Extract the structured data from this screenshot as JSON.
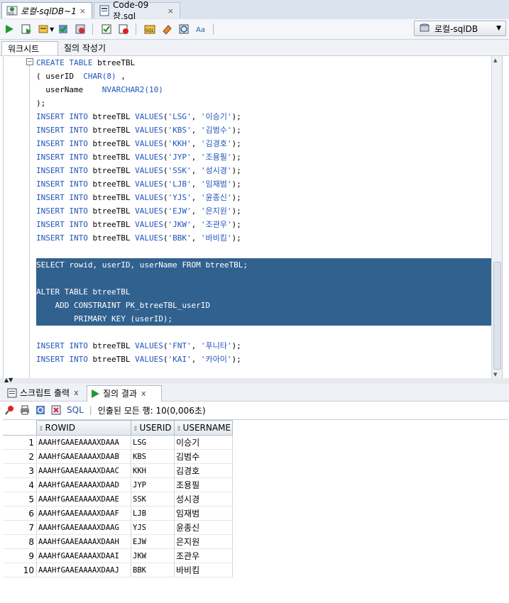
{
  "doc_tabs": [
    {
      "label": "로컬-sqlDB~1",
      "close": "×",
      "icon": "sql-worksheet-icon"
    },
    {
      "label": "Code-09장.sql",
      "close": "×",
      "icon": "sql-file-icon"
    }
  ],
  "toolbar": {
    "connection": "로컬-sqlDB",
    "connection_dropdown": "▼"
  },
  "sub_tabs": {
    "worksheet": "워크시트",
    "query_builder": "질의 작성기"
  },
  "editor": {
    "fold_marker": "−",
    "lines": [
      [
        {
          "t": "CREATE TABLE ",
          "c": "kw"
        },
        {
          "t": "btreeTBL",
          "c": ""
        }
      ],
      [
        {
          "t": "( userID  ",
          "c": ""
        },
        {
          "t": "CHAR(8)",
          "c": "kw"
        },
        {
          "t": " ,",
          "c": ""
        }
      ],
      [
        {
          "t": "  userName    ",
          "c": ""
        },
        {
          "t": "NVARCHAR2(10)",
          "c": "kw"
        }
      ],
      [
        {
          "t": ");",
          "c": ""
        }
      ],
      [
        {
          "t": "INSERT INTO ",
          "c": "kw"
        },
        {
          "t": "btreeTBL ",
          "c": ""
        },
        {
          "t": "VALUES",
          "c": "kw"
        },
        {
          "t": "(",
          "c": ""
        },
        {
          "t": "'LSG'",
          "c": "str"
        },
        {
          "t": ", ",
          "c": ""
        },
        {
          "t": "'이승기'",
          "c": "str"
        },
        {
          "t": ");",
          "c": ""
        }
      ],
      [
        {
          "t": "INSERT INTO ",
          "c": "kw"
        },
        {
          "t": "btreeTBL ",
          "c": ""
        },
        {
          "t": "VALUES",
          "c": "kw"
        },
        {
          "t": "(",
          "c": ""
        },
        {
          "t": "'KBS'",
          "c": "str"
        },
        {
          "t": ", ",
          "c": ""
        },
        {
          "t": "'김범수'",
          "c": "str"
        },
        {
          "t": ");",
          "c": ""
        }
      ],
      [
        {
          "t": "INSERT INTO ",
          "c": "kw"
        },
        {
          "t": "btreeTBL ",
          "c": ""
        },
        {
          "t": "VALUES",
          "c": "kw"
        },
        {
          "t": "(",
          "c": ""
        },
        {
          "t": "'KKH'",
          "c": "str"
        },
        {
          "t": ", ",
          "c": ""
        },
        {
          "t": "'김경호'",
          "c": "str"
        },
        {
          "t": ");",
          "c": ""
        }
      ],
      [
        {
          "t": "INSERT INTO ",
          "c": "kw"
        },
        {
          "t": "btreeTBL ",
          "c": ""
        },
        {
          "t": "VALUES",
          "c": "kw"
        },
        {
          "t": "(",
          "c": ""
        },
        {
          "t": "'JYP'",
          "c": "str"
        },
        {
          "t": ", ",
          "c": ""
        },
        {
          "t": "'조용필'",
          "c": "str"
        },
        {
          "t": ");",
          "c": ""
        }
      ],
      [
        {
          "t": "INSERT INTO ",
          "c": "kw"
        },
        {
          "t": "btreeTBL ",
          "c": ""
        },
        {
          "t": "VALUES",
          "c": "kw"
        },
        {
          "t": "(",
          "c": ""
        },
        {
          "t": "'SSK'",
          "c": "str"
        },
        {
          "t": ", ",
          "c": ""
        },
        {
          "t": "'성시경'",
          "c": "str"
        },
        {
          "t": ");",
          "c": ""
        }
      ],
      [
        {
          "t": "INSERT INTO ",
          "c": "kw"
        },
        {
          "t": "btreeTBL ",
          "c": ""
        },
        {
          "t": "VALUES",
          "c": "kw"
        },
        {
          "t": "(",
          "c": ""
        },
        {
          "t": "'LJB'",
          "c": "str"
        },
        {
          "t": ", ",
          "c": ""
        },
        {
          "t": "'임재범'",
          "c": "str"
        },
        {
          "t": ");",
          "c": ""
        }
      ],
      [
        {
          "t": "INSERT INTO ",
          "c": "kw"
        },
        {
          "t": "btreeTBL ",
          "c": ""
        },
        {
          "t": "VALUES",
          "c": "kw"
        },
        {
          "t": "(",
          "c": ""
        },
        {
          "t": "'YJS'",
          "c": "str"
        },
        {
          "t": ", ",
          "c": ""
        },
        {
          "t": "'윤종신'",
          "c": "str"
        },
        {
          "t": ");",
          "c": ""
        }
      ],
      [
        {
          "t": "INSERT INTO ",
          "c": "kw"
        },
        {
          "t": "btreeTBL ",
          "c": ""
        },
        {
          "t": "VALUES",
          "c": "kw"
        },
        {
          "t": "(",
          "c": ""
        },
        {
          "t": "'EJW'",
          "c": "str"
        },
        {
          "t": ", ",
          "c": ""
        },
        {
          "t": "'은지원'",
          "c": "str"
        },
        {
          "t": ");",
          "c": ""
        }
      ],
      [
        {
          "t": "INSERT INTO ",
          "c": "kw"
        },
        {
          "t": "btreeTBL ",
          "c": ""
        },
        {
          "t": "VALUES",
          "c": "kw"
        },
        {
          "t": "(",
          "c": ""
        },
        {
          "t": "'JKW'",
          "c": "str"
        },
        {
          "t": ", ",
          "c": ""
        },
        {
          "t": "'조관우'",
          "c": "str"
        },
        {
          "t": ");",
          "c": ""
        }
      ],
      [
        {
          "t": "INSERT INTO ",
          "c": "kw"
        },
        {
          "t": "btreeTBL ",
          "c": ""
        },
        {
          "t": "VALUES",
          "c": "kw"
        },
        {
          "t": "(",
          "c": ""
        },
        {
          "t": "'BBK'",
          "c": "str"
        },
        {
          "t": ", ",
          "c": ""
        },
        {
          "t": "'바비킴'",
          "c": "str"
        },
        {
          "t": ");",
          "c": ""
        }
      ],
      [],
      [
        {
          "t": "SELECT ",
          "c": "kw",
          "sel": 1
        },
        {
          "t": "rowid, userID, userName ",
          "c": "",
          "sel": 1
        },
        {
          "t": "FROM ",
          "c": "kw",
          "sel": 1
        },
        {
          "t": "btreeTBL;",
          "c": "",
          "sel": 1
        }
      ],
      [
        {
          "t": "",
          "c": "",
          "sel": 1
        }
      ],
      [
        {
          "t": "ALTER TABLE ",
          "c": "kw",
          "sel": 1
        },
        {
          "t": "btreeTBL",
          "c": "",
          "sel": 1
        }
      ],
      [
        {
          "t": "    ADD CONSTRAINT ",
          "c": "kw",
          "sel": 1
        },
        {
          "t": "PK_btreeTBL_userID",
          "c": "",
          "sel": 1
        }
      ],
      [
        {
          "t": "        PRIMARY KEY ",
          "c": "kw",
          "sel": 1
        },
        {
          "t": "(userID);",
          "c": "",
          "sel": 1
        }
      ],
      [],
      [
        {
          "t": "INSERT INTO ",
          "c": "kw"
        },
        {
          "t": "btreeTBL ",
          "c": ""
        },
        {
          "t": "VALUES",
          "c": "kw"
        },
        {
          "t": "(",
          "c": ""
        },
        {
          "t": "'FNT'",
          "c": "str"
        },
        {
          "t": ", ",
          "c": ""
        },
        {
          "t": "'푸니타'",
          "c": "str"
        },
        {
          "t": ");",
          "c": ""
        }
      ],
      [
        {
          "t": "INSERT INTO ",
          "c": "kw"
        },
        {
          "t": "btreeTBL ",
          "c": ""
        },
        {
          "t": "VALUES",
          "c": "kw"
        },
        {
          "t": "(",
          "c": ""
        },
        {
          "t": "'KAI'",
          "c": "str"
        },
        {
          "t": ", ",
          "c": ""
        },
        {
          "t": "'카아이'",
          "c": "str"
        },
        {
          "t": ");",
          "c": ""
        }
      ]
    ]
  },
  "results_tabs": {
    "script_output": "스크립트 출력",
    "query_result": "질의 결과",
    "close": "x"
  },
  "results_toolbar": {
    "sql_label": "SQL",
    "status": "인출된 모든 행: 10(0,006초)"
  },
  "results_grid": {
    "columns": [
      "ROWID",
      "USERID",
      "USERNAME"
    ],
    "sort_glyph": "⇕",
    "rows": [
      [
        "1",
        "AAAHfGAAEAAAAXDAAA",
        "LSG",
        "이승기"
      ],
      [
        "2",
        "AAAHfGAAEAAAAXDAAB",
        "KBS",
        "김범수"
      ],
      [
        "3",
        "AAAHfGAAEAAAAXDAAC",
        "KKH",
        "김경호"
      ],
      [
        "4",
        "AAAHfGAAEAAAAXDAAD",
        "JYP",
        "조용필"
      ],
      [
        "5",
        "AAAHfGAAEAAAAXDAAE",
        "SSK",
        "성시경"
      ],
      [
        "6",
        "AAAHfGAAEAAAAXDAAF",
        "LJB",
        "임재범"
      ],
      [
        "7",
        "AAAHfGAAEAAAAXDAAG",
        "YJS",
        "윤종신"
      ],
      [
        "8",
        "AAAHfGAAEAAAAXDAAH",
        "EJW",
        "은지원"
      ],
      [
        "9",
        "AAAHfGAAEAAAAXDAAI",
        "JKW",
        "조관우"
      ],
      [
        "10",
        "AAAHfGAAEAAAAXDAAJ",
        "BBK",
        "바비킴"
      ]
    ]
  },
  "colors": {
    "selection": "#31618f",
    "keyword": "#2255bb"
  }
}
